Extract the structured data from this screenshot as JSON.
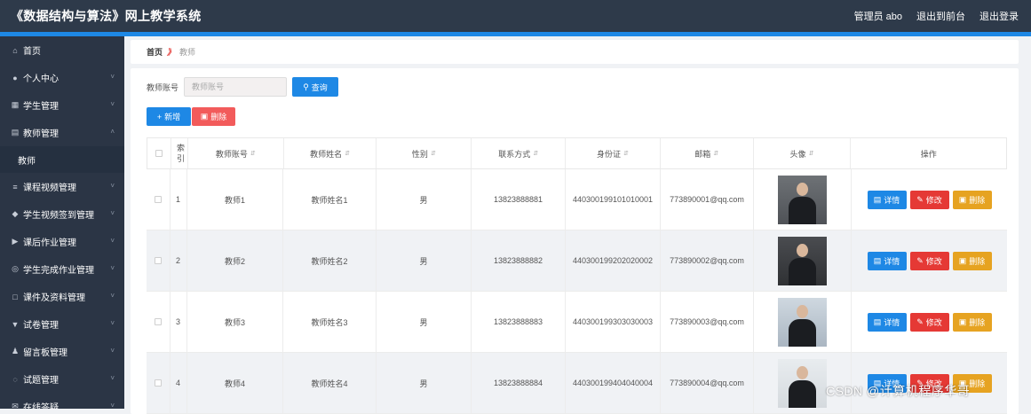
{
  "header": {
    "app_title": "《数据结构与算法》网上教学系统",
    "admin": "管理员 abo",
    "front_link": "退出到前台",
    "logout": "退出登录"
  },
  "sidebar": {
    "items": [
      {
        "label": "首页",
        "icon": "home-icon",
        "glyph": "⌂",
        "has_chevron": false
      },
      {
        "label": "个人中心",
        "icon": "user-icon",
        "glyph": "●",
        "has_chevron": true
      },
      {
        "label": "学生管理",
        "icon": "grid-icon",
        "glyph": "▦",
        "has_chevron": true
      },
      {
        "label": "教师管理",
        "icon": "teacher-icon",
        "glyph": "▤",
        "has_chevron": true,
        "expanded": true
      },
      {
        "label": "教师",
        "sub": true
      },
      {
        "label": "课程视频管理",
        "icon": "sliders-icon",
        "glyph": "≡",
        "has_chevron": true
      },
      {
        "label": "学生视频签到管理",
        "icon": "location-icon",
        "glyph": "◆",
        "has_chevron": true
      },
      {
        "label": "课后作业管理",
        "icon": "flag-icon",
        "glyph": "▶",
        "has_chevron": true
      },
      {
        "label": "学生完成作业管理",
        "icon": "settings-icon",
        "glyph": "◎",
        "has_chevron": true
      },
      {
        "label": "课件及资料管理",
        "icon": "box-icon",
        "glyph": "□",
        "has_chevron": true
      },
      {
        "label": "试卷管理",
        "icon": "trophy-icon",
        "glyph": "▼",
        "has_chevron": true
      },
      {
        "label": "留言板管理",
        "icon": "person-icon",
        "glyph": "♟",
        "has_chevron": true
      },
      {
        "label": "试题管理",
        "icon": "bulb-icon",
        "glyph": "◌",
        "has_chevron": true
      },
      {
        "label": "在线答疑",
        "icon": "mail-icon",
        "glyph": "✉",
        "has_chevron": true
      }
    ]
  },
  "breadcrumb": {
    "home": "首页",
    "separator": "》",
    "current": "教师"
  },
  "search": {
    "label": "教师账号",
    "placeholder": "教师账号",
    "button": "查询"
  },
  "actions": {
    "add": "新增",
    "delete": "删除"
  },
  "table": {
    "columns": [
      "索引",
      "教师账号",
      "教师姓名",
      "性别",
      "联系方式",
      "身份证",
      "邮箱",
      "头像",
      "操作"
    ],
    "rows": [
      {
        "index": "1",
        "account": "教师1",
        "name": "教师姓名1",
        "gender": "男",
        "phone": "13823888881",
        "id_card": "440300199101010001",
        "email": "773890001@qq.com"
      },
      {
        "index": "2",
        "account": "教师2",
        "name": "教师姓名2",
        "gender": "男",
        "phone": "13823888882",
        "id_card": "440300199202020002",
        "email": "773890002@qq.com"
      },
      {
        "index": "3",
        "account": "教师3",
        "name": "教师姓名3",
        "gender": "男",
        "phone": "13823888883",
        "id_card": "440300199303030003",
        "email": "773890003@qq.com"
      },
      {
        "index": "4",
        "account": "教师4",
        "name": "教师姓名4",
        "gender": "男",
        "phone": "13823888884",
        "id_card": "440300199404040004",
        "email": "773890004@qq.com"
      }
    ],
    "row_buttons": {
      "detail": "详情",
      "edit": "修改",
      "delete": "删除"
    }
  },
  "watermark": "CSDN @计算机程序华哥",
  "colors": {
    "topbar": "#2e3a4a",
    "sidebar": "#2b3545",
    "accent": "#1e88e5",
    "danger": "#e53935",
    "warning": "#e6a321"
  }
}
